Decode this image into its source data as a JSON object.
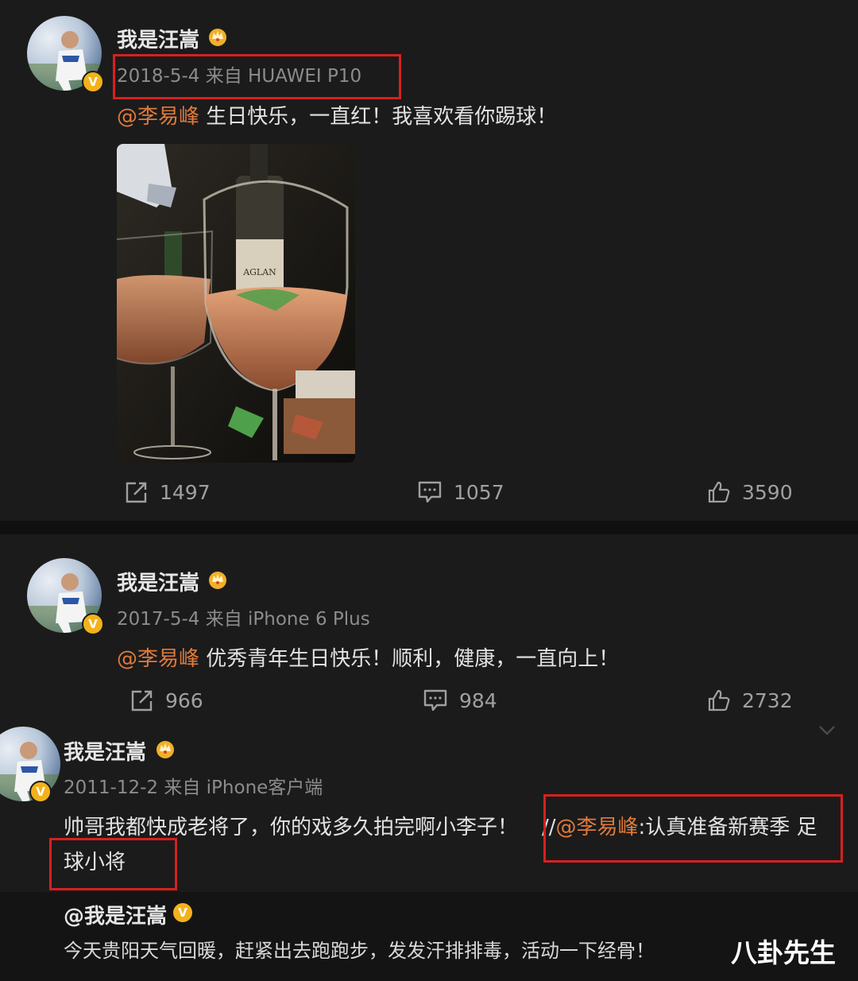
{
  "posts": [
    {
      "author": "我是汪嵩",
      "meta": "2018-5-4 来自 HUAWEI P10",
      "mention": "@李易峰",
      "body": " 生日快乐，一直红！我喜欢看你踢球！",
      "actions": {
        "repost": "1497",
        "comment": "1057",
        "like": "3590"
      },
      "image": {
        "label_text": "AGLAN"
      }
    },
    {
      "author": "我是汪嵩",
      "meta": "2017-5-4 来自 iPhone 6 Plus",
      "mention": "@李易峰",
      "body": " 优秀青年生日快乐！顺利，健康，一直向上！",
      "actions": {
        "repost": "966",
        "comment": "984",
        "like": "2732"
      }
    },
    {
      "author": "我是汪嵩",
      "meta": "2011-12-2 来自 iPhone客户端",
      "body_line1": "帅哥我都快成老将了，你的戏多久拍完啊小李子！",
      "quote_prefix": "//",
      "quote_mention": "@李易峰",
      "quote_text": ":认真准备新赛季 足",
      "body_line2": "球小将"
    }
  ],
  "repost": {
    "author": "@我是汪嵩",
    "text": "今天贵阳天气回暖，赶紧出去跑跑步，发发汗排排毒，活动一下经骨！"
  },
  "watermark": "八卦先生",
  "colors": {
    "background": "#101010",
    "card": "#1b1b1b",
    "mention": "#e07a3c",
    "highlight_box": "#d7201f",
    "verified": "#f3b21b"
  },
  "icons": [
    "repost-icon",
    "comment-icon",
    "like-icon",
    "crown-icon",
    "verified-icon",
    "chevron-down-icon"
  ]
}
